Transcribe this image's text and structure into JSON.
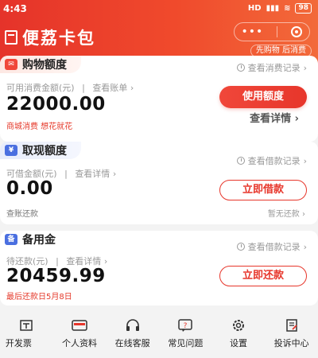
{
  "status": {
    "time": "4:43",
    "signal": "HD",
    "battery": "98"
  },
  "app": {
    "name": "便荔卡包",
    "capsule_dots": "•••",
    "slogan": "先购物 后消费"
  },
  "shopping": {
    "title": "购物额度",
    "icon_text": "✉",
    "record_link": "查看消费记录",
    "available_label": "可用消费金额(元)",
    "bill_link": "查看账单",
    "amount": "22000.00",
    "note": "商城消费 想花就花",
    "use_button": "使用额度",
    "details_link": "查看详情"
  },
  "cash": {
    "title": "取现额度",
    "icon_text": "¥",
    "record_link": "查看借款记录",
    "borrowable_label": "可借金额(元)",
    "details_link": "查看详情",
    "amount": "0.00",
    "borrow_button": "立即借款",
    "left_note": "查账还款",
    "right_note": "暂无还款"
  },
  "reserve": {
    "title": "备用金",
    "icon_text": "备",
    "record_link": "查看借款记录",
    "due_label": "待还款(元)",
    "details_link": "查看详情",
    "amount": "20459.99",
    "due_date": "最后还款日5月8日",
    "repay_button": "立即还款"
  },
  "nav": [
    {
      "label": "开发票",
      "icon": "invoice-icon"
    },
    {
      "label": "个人资料",
      "icon": "profile-card-icon"
    },
    {
      "label": "在线客服",
      "icon": "headset-icon"
    },
    {
      "label": "常见问题",
      "icon": "faq-icon"
    },
    {
      "label": "设置",
      "icon": "gear-icon"
    },
    {
      "label": "投诉中心",
      "icon": "complaint-icon"
    }
  ],
  "colors": {
    "brand": "#e7362b",
    "brand_light": "#f26a3a",
    "accent_blue": "#4a6fe0"
  }
}
